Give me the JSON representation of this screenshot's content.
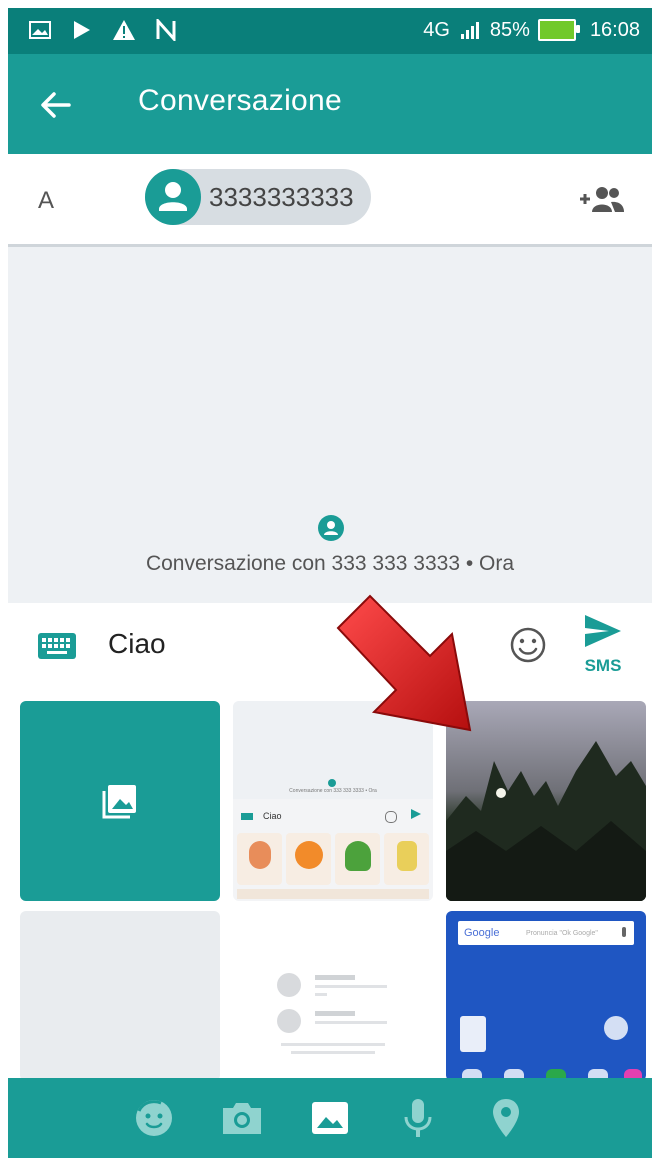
{
  "status_bar": {
    "network": "4G",
    "battery_percent": "85%",
    "time": "16:08"
  },
  "app_bar": {
    "title": "Conversazione"
  },
  "recipient": {
    "label": "A",
    "phone": "3333333333"
  },
  "conversation": {
    "info": "Conversazione con 333 333 3333 • Ora"
  },
  "compose": {
    "message": "Ciao",
    "send_label": "SMS"
  },
  "thumbs": {
    "mini_conversation_info": "Conversazione con 333 333 3333 • Ora",
    "mini_message": "Ciao",
    "search_brand": "Google",
    "search_hint": "Pronuncia \"Ok Google\""
  },
  "bottom_tabs": [
    {
      "icon": "sticker-icon"
    },
    {
      "icon": "camera-icon"
    },
    {
      "icon": "gallery-icon",
      "selected": true
    },
    {
      "icon": "microphone-icon"
    },
    {
      "icon": "location-icon"
    }
  ],
  "colors": {
    "statusbar": "#0a7f7a",
    "primary": "#1a9c96",
    "background": "#eef1f4",
    "chip": "#d7dde2",
    "arrow": "#d81e1e"
  }
}
